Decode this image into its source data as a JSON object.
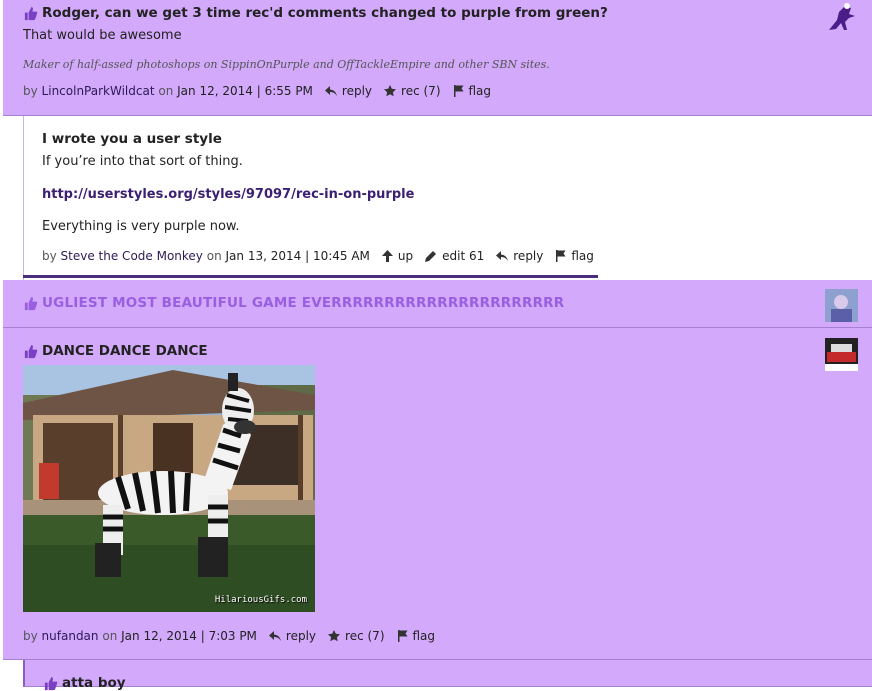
{
  "comments": [
    {
      "title": "Rodger, can we get 3 time rec'd comments changed to purple from green?",
      "body": "That would be awesome",
      "signature": "Maker of half-assed photoshops on SippinOnPurple and OffTackleEmpire and other SBN sites.",
      "by": "by",
      "user": "LincolnParkWildcat",
      "on": "on",
      "date": "Jan 12, 2014 | 6:55 PM",
      "reply": "reply",
      "rec": "rec (7)",
      "flag": "flag"
    },
    {
      "title": "I wrote you a user style",
      "body": "If you’re into that sort of thing.",
      "link": "http://userstyles.org/styles/97097/rec-in-on-purple",
      "body2": "Everything is very purple now.",
      "by": "by",
      "user": "Steve the Code Monkey",
      "on": "on",
      "date": "Jan 13, 2014 | 10:45 AM",
      "up": "up",
      "edit": "edit 61",
      "reply": "reply",
      "flag": "flag"
    },
    {
      "title": "UGLIEST MOST BEAUTIFUL GAME EVERRRRRRRRRRRRRRRRRRRRRR"
    },
    {
      "title": "DANCE DANCE DANCE",
      "gif_caption": "HilariousGifs.com",
      "by": "by",
      "user": "nufandan",
      "on": "on",
      "date": "Jan 12, 2014 | 7:03 PM",
      "reply": "reply",
      "rec": "rec (7)",
      "flag": "flag"
    },
    {
      "title": "atta boy"
    }
  ],
  "colors": {
    "rec_bg": "#d3a9fb",
    "accent": "#4b2d7f",
    "collapsed_title": "#9a5fe0"
  }
}
